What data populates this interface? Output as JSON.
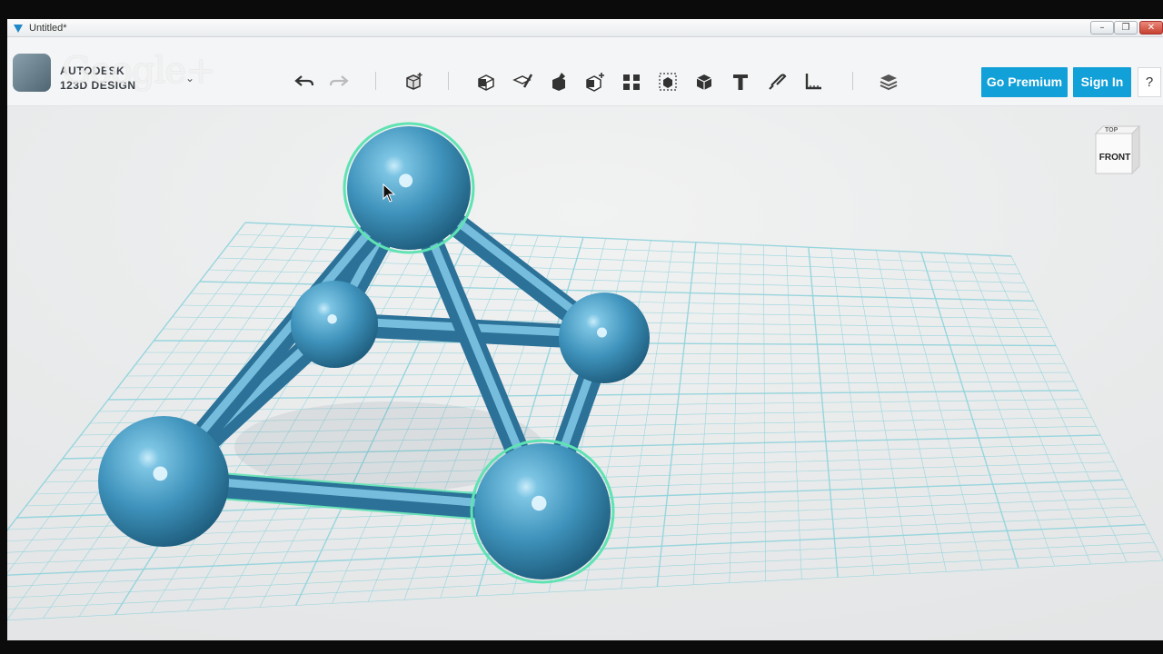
{
  "window": {
    "title": "Untitled*",
    "controls": {
      "minimize": "–",
      "maximize": "❐",
      "close": "✕"
    }
  },
  "logo": {
    "line1": "AUTODESK",
    "line2": "123D DESIGN",
    "watermark": "Google+"
  },
  "toolbar": {
    "tools": [
      {
        "name": "undo-icon"
      },
      {
        "name": "redo-icon"
      },
      {
        "name": "transform-icon"
      },
      {
        "name": "primitives-icon"
      },
      {
        "name": "sketch-icon"
      },
      {
        "name": "construct-icon"
      },
      {
        "name": "modify-icon"
      },
      {
        "name": "pattern-icon"
      },
      {
        "name": "grouping-icon"
      },
      {
        "name": "combine-icon"
      },
      {
        "name": "text-icon"
      },
      {
        "name": "snap-icon"
      },
      {
        "name": "measure-icon"
      },
      {
        "name": "material-icon"
      }
    ],
    "go_premium": "Go Premium",
    "sign_in": "Sign In",
    "help": "?"
  },
  "viewcube": {
    "face": "FRONT",
    "top": "TOP"
  },
  "colors": {
    "accent": "#12a0d8",
    "model": "#4f9fc4",
    "selection": "#5fe3b3",
    "grid": "#8fd3dc"
  }
}
